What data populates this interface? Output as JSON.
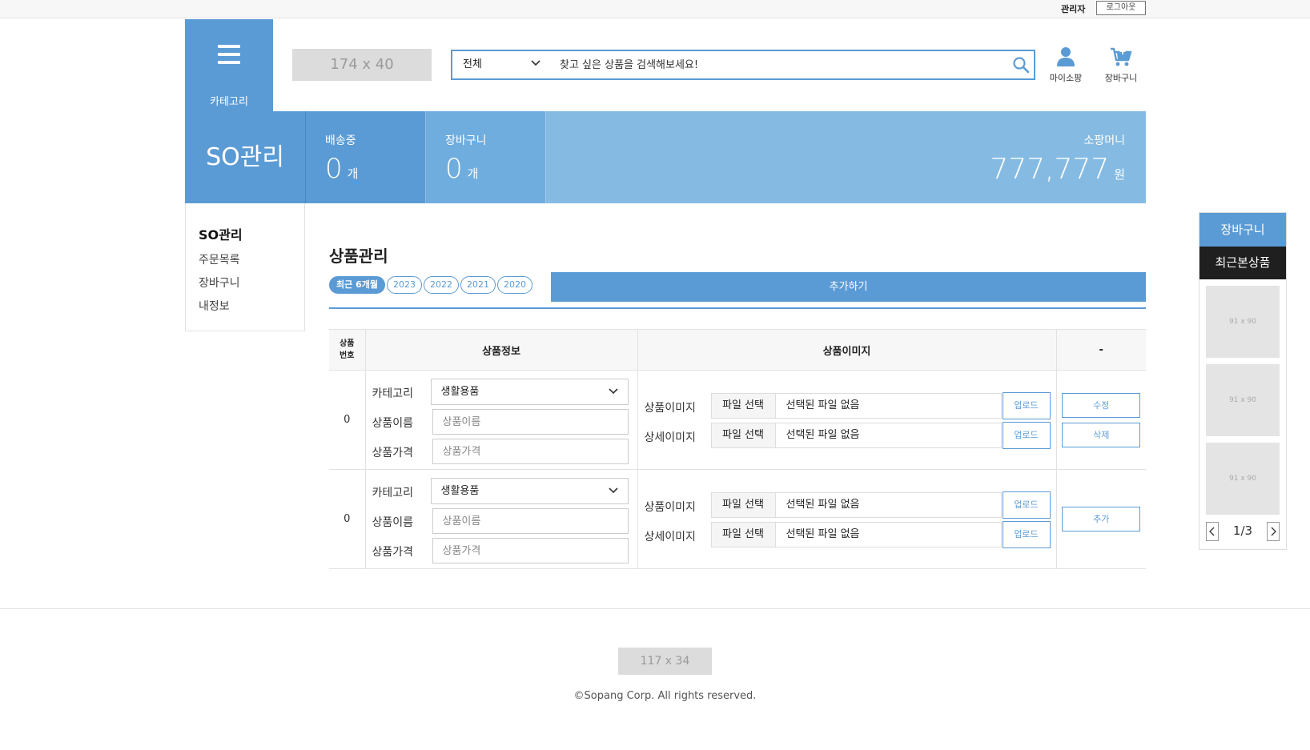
{
  "topbar": {
    "admin": "관리자",
    "logout": "로그아웃"
  },
  "header": {
    "category_label": "카테고리",
    "logo_placeholder": "174 x 40",
    "search": {
      "scope": "전체",
      "placeholder": "찾고 싶은 상품을 검색해보세요!"
    },
    "mypage": "마이소팡",
    "cart": "장바구니"
  },
  "stats": {
    "title": "SO관리",
    "shipping": {
      "label": "배송중",
      "value": "0",
      "unit": "개"
    },
    "cart": {
      "label": "장바구니",
      "value": "0",
      "unit": "개"
    },
    "money": {
      "label": "소팡머니",
      "value": "777,777",
      "unit": "원"
    }
  },
  "sidebar": {
    "heading": "SO관리",
    "items": [
      "주문목록",
      "장바구니",
      "내정보"
    ]
  },
  "main": {
    "title": "상품관리",
    "chips": [
      "최근 6개월",
      "2023",
      "2022",
      "2021",
      "2020"
    ],
    "add_button": "추가하기",
    "table": {
      "headers": {
        "no_line1": "상품",
        "no_line2": "번호",
        "info": "상품정보",
        "image": "상품이미지",
        "action": "-"
      },
      "labels": {
        "category": "카테고리",
        "name": "상품이름",
        "price": "상품가격",
        "image": "상품이미지",
        "detail_image": "상세이미지",
        "file_button": "파일 선택",
        "no_file": "선택된 파일 없음",
        "upload": "업로드"
      },
      "rows": [
        {
          "no": "0",
          "category": "생활용품",
          "name_placeholder": "상품이름",
          "price_placeholder": "상품가격",
          "actions": [
            "수정",
            "삭제"
          ]
        },
        {
          "no": "0",
          "category": "생활용품",
          "name_placeholder": "상품이름",
          "price_placeholder": "상품가격",
          "actions": [
            "추가"
          ]
        }
      ]
    }
  },
  "footer": {
    "logo_placeholder": "117 x 34",
    "copyright": "©Sopang Corp. All rights reserved."
  },
  "side_panel": {
    "cart": "장바구니",
    "recent": "최근본상품",
    "thumbs": [
      "91 x 90",
      "91 x 90",
      "91 x 90"
    ],
    "page": "1/3"
  },
  "colors": {
    "accent": "#5b9bd5",
    "accent_light": "#85bbe3",
    "dark": "#1f1f1f"
  }
}
